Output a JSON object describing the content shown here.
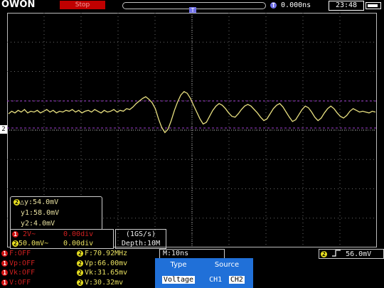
{
  "header": {
    "logo": "OWON",
    "run_state": "Stop",
    "trigger_marker": "T",
    "time_position": "0.000ns",
    "clock": "23:48"
  },
  "channel_marker": "2",
  "cursor": {
    "badge": "2",
    "delta": "△y:54.0mV",
    "y1": "y1:58.0mV",
    "y2": "y2:4.0mV"
  },
  "channels": {
    "ch1": {
      "badge": "1",
      "scale": "2V~",
      "offset": "0.00div"
    },
    "ch2": {
      "badge": "2",
      "scale": "50.0mV~",
      "offset": "0.00div"
    }
  },
  "acquisition": {
    "rate": "(1GS/s)",
    "depth": "Depth:10M"
  },
  "timebase": "M:10ns",
  "trigger": {
    "badge": "2",
    "icon": "rising-edge",
    "level": "56.0mV"
  },
  "measurements": {
    "ch1": [
      {
        "badge": "1",
        "text": "F:OFF"
      },
      {
        "badge": "1",
        "text": "Vp:OFF"
      },
      {
        "badge": "1",
        "text": "Vk:OFF"
      },
      {
        "badge": "1",
        "text": "V:OFF"
      }
    ],
    "ch2": [
      {
        "badge": "2",
        "text": "F:70.92MHz"
      },
      {
        "badge": "2",
        "text": "Vp:66.00mv"
      },
      {
        "badge": "2",
        "text": "Vk:31.65mv"
      },
      {
        "badge": "2",
        "text": "V:30.32mv"
      }
    ]
  },
  "menu": {
    "type_label": "Type",
    "type_value": "Voltage",
    "source_label": "Source",
    "source_ch1": "CH1",
    "source_ch2": "CH2"
  },
  "colors": {
    "trace": "#e8e080",
    "grid": "#6a6a6a",
    "cursor": "#a040d0",
    "ch1": "#d01010",
    "ch2": "#e8e020",
    "menu": "#2070d8"
  },
  "waveform": {
    "samples": [
      0,
      0.3,
      0.1,
      0.4,
      0.2,
      0.5,
      0.1,
      0.3,
      0.2,
      0.4,
      0.1,
      0.3,
      0.5,
      0.2,
      0.4,
      0.1,
      0.3,
      0.2,
      0.4,
      0.3,
      0.5,
      0.2,
      0.4,
      0.1,
      0.3,
      0.4,
      0.2,
      0.5,
      0.3,
      0.1,
      0.4,
      0.2,
      0.3,
      0.5,
      0.2,
      0.4,
      0.3,
      0.6,
      0.5,
      0.8,
      1.2,
      1.5,
      1.8,
      2.0,
      1.7,
      1.3,
      0.6,
      -0.6,
      -1.6,
      -2.2,
      -1.8,
      -0.8,
      0.4,
      1.4,
      2.2,
      2.6,
      2.4,
      1.8,
      1.0,
      0.2,
      -0.6,
      -1.2,
      -1.0,
      -0.3,
      0.4,
      0.9,
      1.2,
      1.0,
      0.6,
      0.1,
      -0.3,
      -0.4,
      0.0,
      0.5,
      0.9,
      1.1,
      0.9,
      0.5,
      0.1,
      -0.4,
      -0.8,
      -0.6,
      0.0,
      0.6,
      1.0,
      1.2,
      0.8,
      0.2,
      -0.4,
      -0.9,
      -0.7,
      -0.1,
      0.5,
      0.9,
      0.7,
      0.2,
      -0.4,
      -0.8,
      -0.5,
      0.1,
      0.6,
      0.9,
      0.6,
      0.1,
      -0.3,
      -0.5,
      -0.2,
      0.3,
      0.6,
      0.4,
      0.2,
      0.3,
      0.2,
      0.1,
      0.3,
      0.2
    ]
  }
}
